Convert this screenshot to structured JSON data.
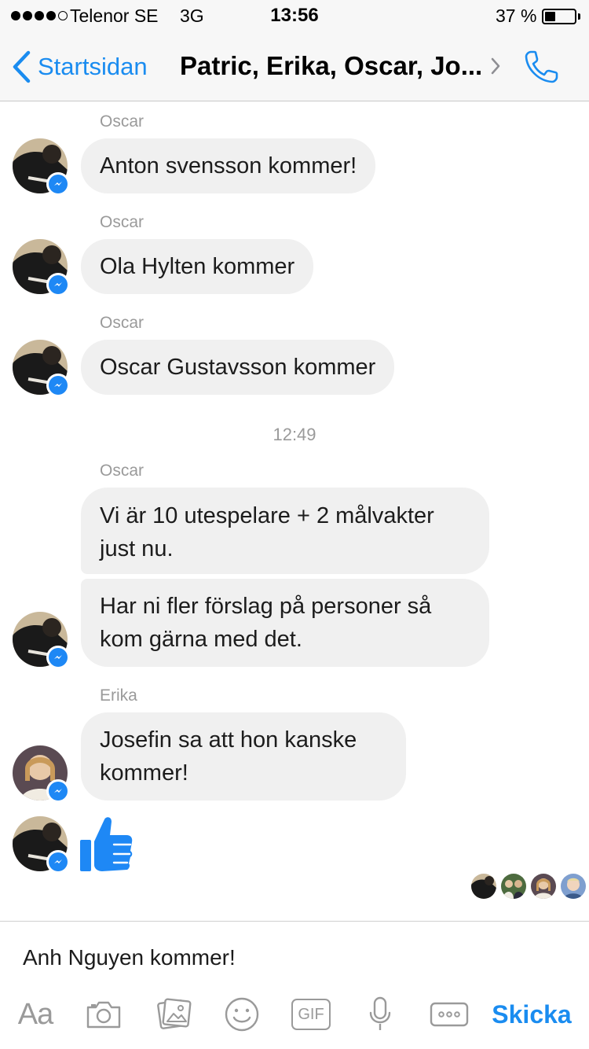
{
  "status_bar": {
    "signal_filled": 4,
    "signal_total": 5,
    "carrier": "Telenor SE",
    "network": "3G",
    "time": "13:56",
    "battery_percent": "37 %",
    "battery_level": 0.37
  },
  "nav": {
    "back_label": "Startsidan",
    "title": "Patric, Erika, Oscar, Jo...",
    "accent_color": "#1a8cf0"
  },
  "messages": {
    "m1_sender": "Oscar",
    "m1_text": "Anton svensson kommer!",
    "m2_sender": "Oscar",
    "m2_text": "Ola Hylten kommer",
    "m3_sender": "Oscar",
    "m3_text": "Oscar Gustavsson kommer",
    "timestamp": "12:49",
    "m4_sender": "Oscar",
    "m4_text": "Vi är 10 utespelare + 2 målvakter just nu.",
    "m5_text": "Har ni fler förslag på personer så kom gärna med det.",
    "m6_sender": "Erika",
    "m6_text": "Josefin sa att hon kanske kommer!",
    "m7_sticker": "thumbs-up-icon"
  },
  "composer": {
    "input_value": "Anh Nguyen kommer!",
    "aa_label": "Aa",
    "gif_label": "GIF",
    "send_label": "Skicka"
  },
  "colors": {
    "bubble_bg": "#f0f0f0",
    "messenger_blue": "#1e88f5",
    "secondary_text": "#9a9a9a"
  }
}
